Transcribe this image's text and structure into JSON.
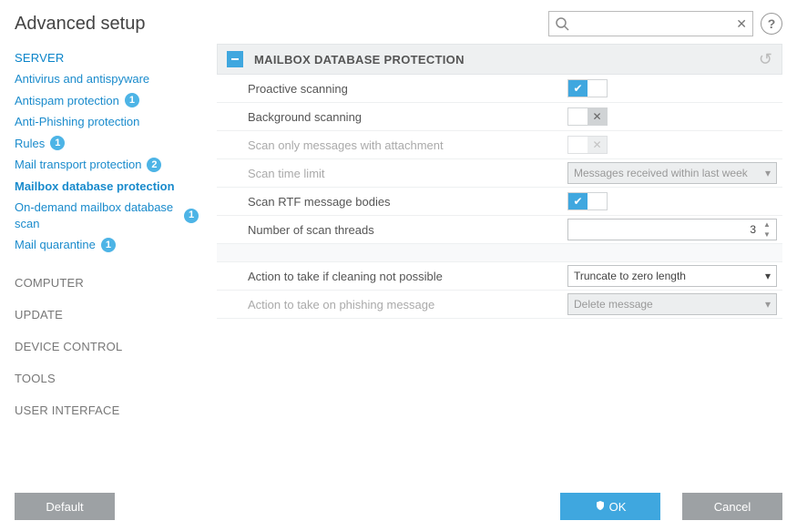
{
  "header": {
    "title": "Advanced setup",
    "search_placeholder": ""
  },
  "sidebar": {
    "sections": [
      {
        "label": "SERVER",
        "style": "blue"
      },
      {
        "label": "COMPUTER",
        "style": "plain"
      },
      {
        "label": "UPDATE",
        "style": "plain"
      },
      {
        "label": "DEVICE CONTROL",
        "style": "plain"
      },
      {
        "label": "TOOLS",
        "style": "plain"
      },
      {
        "label": "USER INTERFACE",
        "style": "plain"
      }
    ],
    "server_items": [
      {
        "label": "Antivirus and antispyware",
        "badge": "",
        "active": false
      },
      {
        "label": "Antispam protection",
        "badge": "1",
        "active": false
      },
      {
        "label": "Anti-Phishing protection",
        "badge": "",
        "active": false
      },
      {
        "label": "Rules",
        "badge": "1",
        "active": false
      },
      {
        "label": "Mail transport protection",
        "badge": "2",
        "active": false
      },
      {
        "label": "Mailbox database protection",
        "badge": "",
        "active": true
      },
      {
        "label": "On-demand mailbox database scan",
        "badge": "1",
        "active": false
      },
      {
        "label": "Mail quarantine",
        "badge": "1",
        "active": false
      }
    ]
  },
  "main": {
    "section_title": "MAILBOX DATABASE PROTECTION",
    "rows": {
      "proactive": {
        "label": "Proactive scanning",
        "state": "on"
      },
      "background": {
        "label": "Background scanning",
        "state": "off"
      },
      "attach": {
        "label": "Scan only messages with attachment",
        "state": "off"
      },
      "timelimit": {
        "label": "Scan time limit",
        "value": "Messages received within last week"
      },
      "rtf": {
        "label": "Scan RTF message bodies",
        "state": "on"
      },
      "threads": {
        "label": "Number of scan threads",
        "value": "3"
      },
      "cleaning": {
        "label": "Action to take if cleaning not possible",
        "value": "Truncate to zero length"
      },
      "phishing": {
        "label": "Action to take on phishing message",
        "value": "Delete message"
      }
    }
  },
  "footer": {
    "default": "Default",
    "ok": "OK",
    "cancel": "Cancel"
  }
}
